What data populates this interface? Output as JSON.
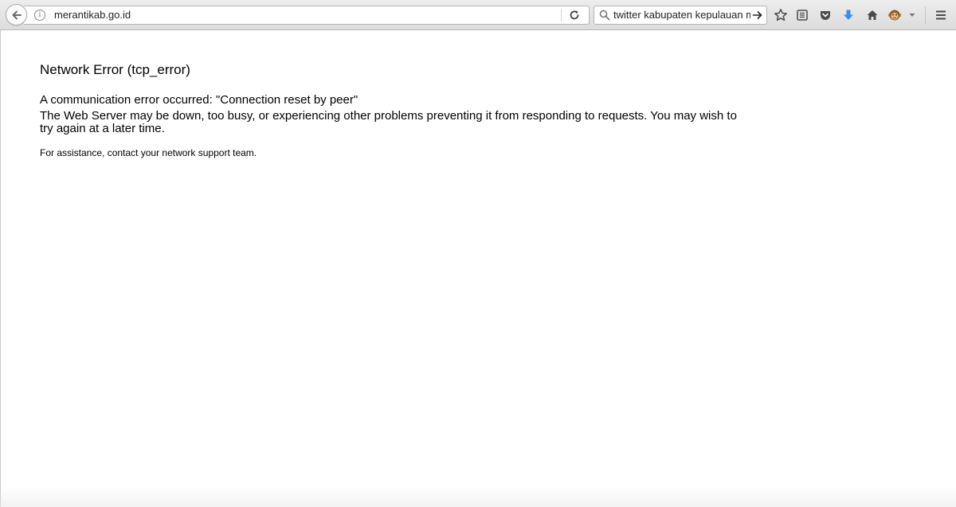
{
  "browser": {
    "url": "merantikab.go.id",
    "search_query": "twitter kabupaten kepulauan me",
    "icons": {
      "back": "back-arrow-icon",
      "info": "site-info-icon",
      "reload": "reload-icon",
      "search": "search-icon",
      "search_go": "arrow-right-icon",
      "bookmark": "star-icon",
      "reader": "reading-list-icon",
      "pocket": "pocket-icon",
      "downloads": "download-arrow-icon",
      "home": "home-icon",
      "addon": "monkey-face-icon",
      "menu": "hamburger-menu-icon"
    },
    "colors": {
      "download_accent": "#3a8ee6",
      "addon_accent": "#c9873a"
    }
  },
  "page": {
    "title": "Network Error (tcp_error)",
    "message": "A communication error occurred: \"Connection reset by peer\"",
    "description": "The Web Server may be down, too busy, or experiencing other problems preventing it from responding to requests. You may wish to try again at a later time.",
    "help": "For assistance, contact your network support team."
  }
}
